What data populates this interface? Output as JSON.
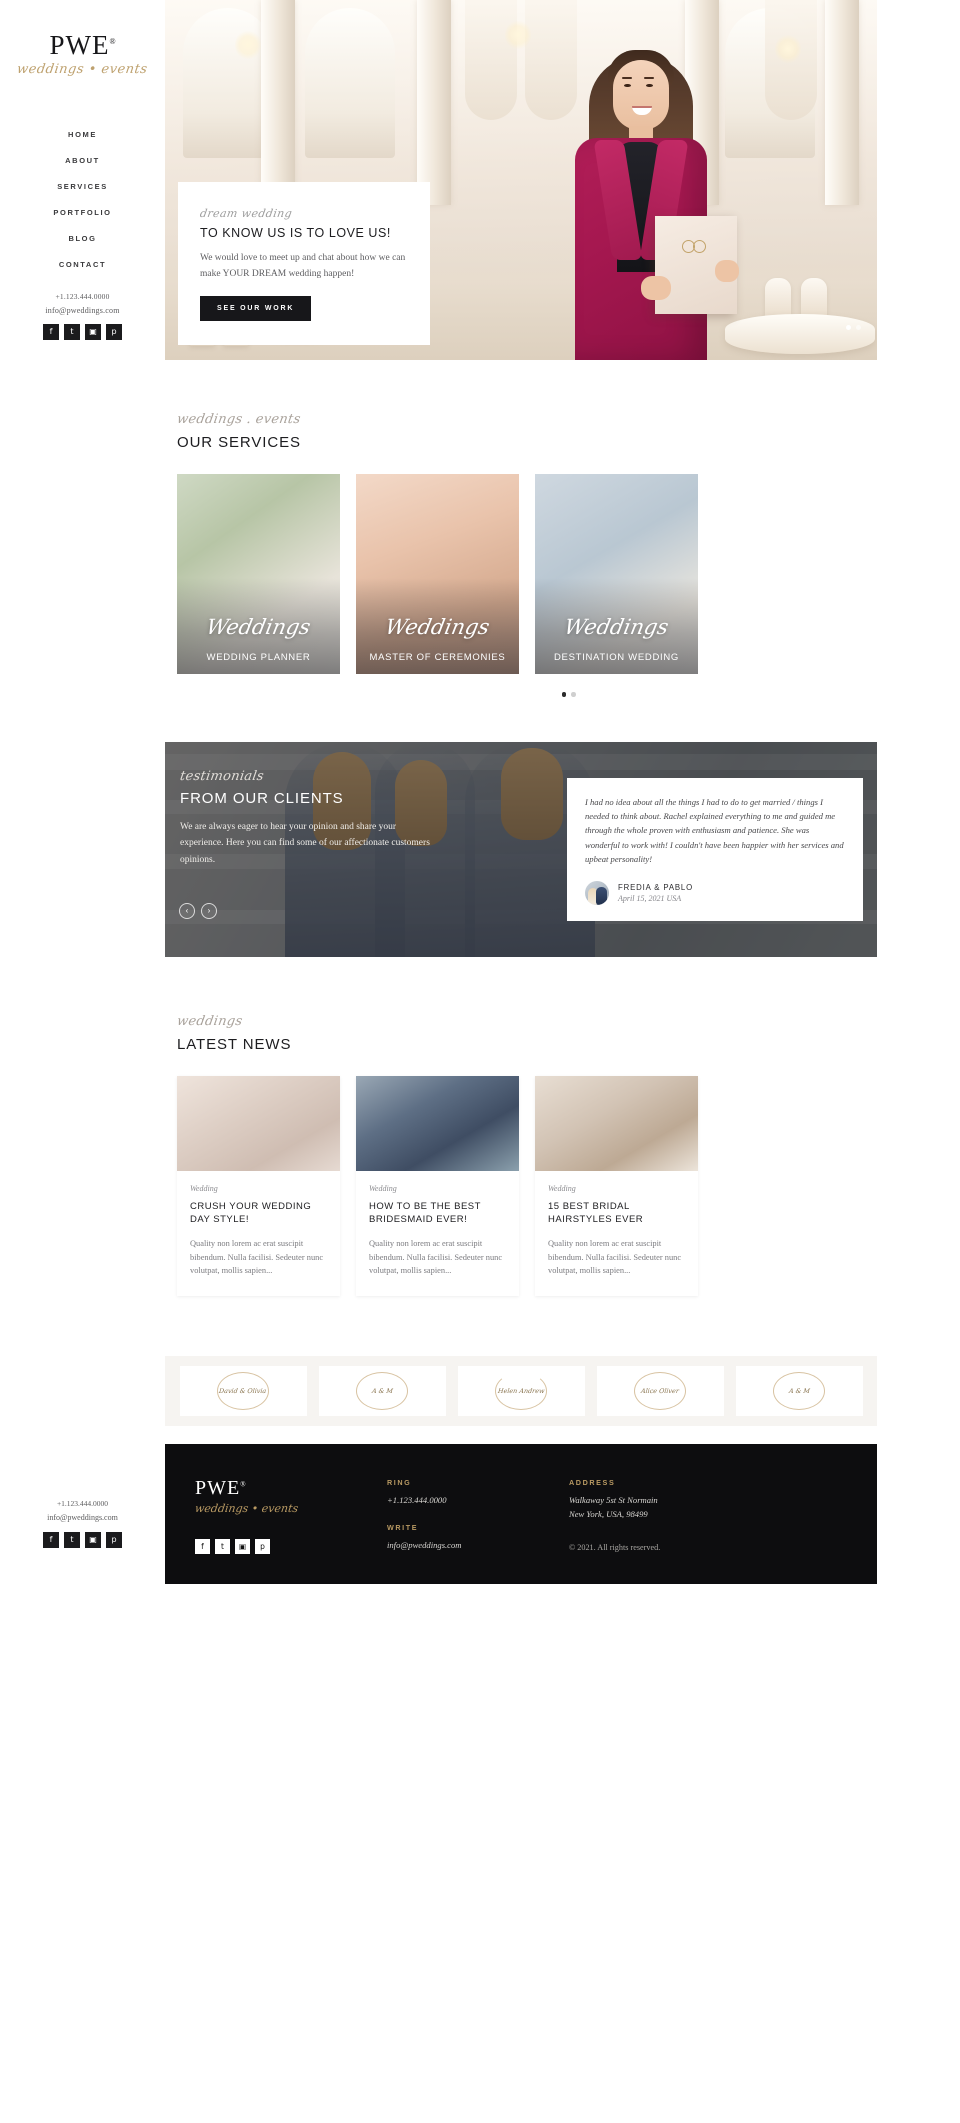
{
  "brand": {
    "name": "PWE",
    "registered": "®",
    "tagline": "weddings • events"
  },
  "sidebar": {
    "nav": [
      {
        "label": "HOME"
      },
      {
        "label": "ABOUT"
      },
      {
        "label": "SERVICES"
      },
      {
        "label": "PORTFOLIO"
      },
      {
        "label": "BLOG"
      },
      {
        "label": "CONTACT"
      }
    ],
    "phone": "+1.123.444.0000",
    "email": "info@pweddings.com",
    "social": [
      {
        "name": "facebook-icon",
        "glyph": "f"
      },
      {
        "name": "twitter-icon",
        "glyph": "t"
      },
      {
        "name": "instagram-icon",
        "glyph": "▣"
      },
      {
        "name": "pinterest-icon",
        "glyph": "p"
      }
    ]
  },
  "hero": {
    "script": "dream wedding",
    "title": "TO KNOW US IS TO LOVE US!",
    "body": "We would love to meet up and chat about how we can make YOUR DREAM wedding happen!",
    "cta": "SEE OUR WORK",
    "dots": 2,
    "active_dot": 1
  },
  "services": {
    "script": "weddings . events",
    "title": "OUR SERVICES",
    "cards": [
      {
        "script": "Weddings",
        "label": "WEDDING PLANNER"
      },
      {
        "script": "Weddings",
        "label": "MASTER OF CEREMONIES"
      },
      {
        "script": "Weddings",
        "label": "DESTINATION WEDDING"
      }
    ],
    "dots": 2,
    "active_dot": 0
  },
  "testimonials": {
    "script": "testimonials",
    "title": "FROM OUR CLIENTS",
    "intro": "We are always eager to hear your opinion and share your experience. Here you can find some of our affectionate customers opinions.",
    "prev": "‹",
    "next": "›",
    "quote": "I had no idea about all the things I had to do to get married / things I needed to think about. Rachel explained everything to me and guided me through the whole proven with enthusiasm and patience. She was wonderful to work with! I couldn't have been happier with her services and upbeat personality!",
    "author": "FREDIA & PABLO",
    "date": "April 15, 2021 USA"
  },
  "news": {
    "script": "weddings",
    "title": "LATEST NEWS",
    "cards": [
      {
        "category": "Wedding",
        "title": "CRUSH YOUR WEDDING DAY STYLE!",
        "excerpt": "Quality non lorem ac erat suscipit bibendum. Nulla facilisi. Sedeuter nunc volutpat, mollis sapien..."
      },
      {
        "category": "Wedding",
        "title": "HOW TO BE THE BEST BRIDESMAID EVER!",
        "excerpt": "Quality non lorem ac erat suscipit bibendum. Nulla facilisi. Sedeuter nunc volutpat, mollis sapien..."
      },
      {
        "category": "Wedding",
        "title": "15 BEST BRIDAL HAIRSTYLES EVER",
        "excerpt": "Quality non lorem ac erat suscipit bibendum. Nulla facilisi. Sedeuter nunc volutpat, mollis sapien..."
      }
    ]
  },
  "partners": [
    {
      "text": "David &\nOlivia"
    },
    {
      "text": "A & M"
    },
    {
      "text": "Helen\nAndrew"
    },
    {
      "text": "Alice\nOliver"
    },
    {
      "text": "A & M"
    }
  ],
  "footer": {
    "ring_label": "RING",
    "ring_value": "+1.123.444.0000",
    "write_label": "WRITE",
    "write_value": "info@pweddings.com",
    "address_label": "ADDRESS",
    "address_line1": "Walkaway 5st St Normain",
    "address_line2": "New York, USA, 98499",
    "copyright": "© 2021. All rights reserved."
  },
  "colors": {
    "gold": "#b99a63",
    "dark": "#0d0d0f",
    "accent_magenta": "#a4174f"
  }
}
